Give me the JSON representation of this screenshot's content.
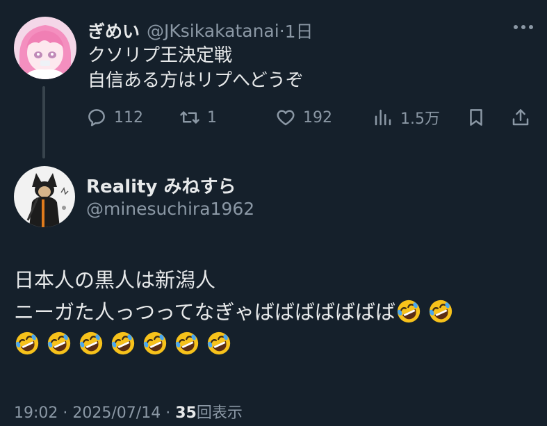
{
  "original_tweet": {
    "display_name": "ぎめい",
    "handle": "@JKsikakatanai",
    "separator": "·",
    "time_ago": "1日",
    "text_lines": [
      "クソリプ王決定戦",
      "自信ある方はリプへどうぞ"
    ],
    "actions": {
      "reply_count": "112",
      "retweet_count": "1",
      "like_count": "192",
      "view_count": "1.5万"
    },
    "icons": [
      "reply-icon",
      "retweet-icon",
      "like-icon",
      "views-icon",
      "bookmark-icon",
      "share-icon",
      "more-icon"
    ]
  },
  "reply_tweet": {
    "display_name": "Reality みねすら",
    "handle": "@minesuchira1962",
    "text_lines": [
      "日本人の黒人は新潟人",
      "ニーガた人っつってなぎゃばばばばばばば"
    ],
    "emoji_name": "rolling-on-floor-laughing",
    "emoji_count_line2": 2,
    "emoji_count_line3": 7,
    "meta": {
      "time": "19:02",
      "date": "2025/07/14",
      "separator": "·",
      "views_count": "35",
      "views_label": "回表示"
    }
  },
  "colors": {
    "background": "#15202b",
    "text_primary": "#e7e9ea",
    "text_secondary": "#8b98a5",
    "thread_line": "#38444d"
  }
}
